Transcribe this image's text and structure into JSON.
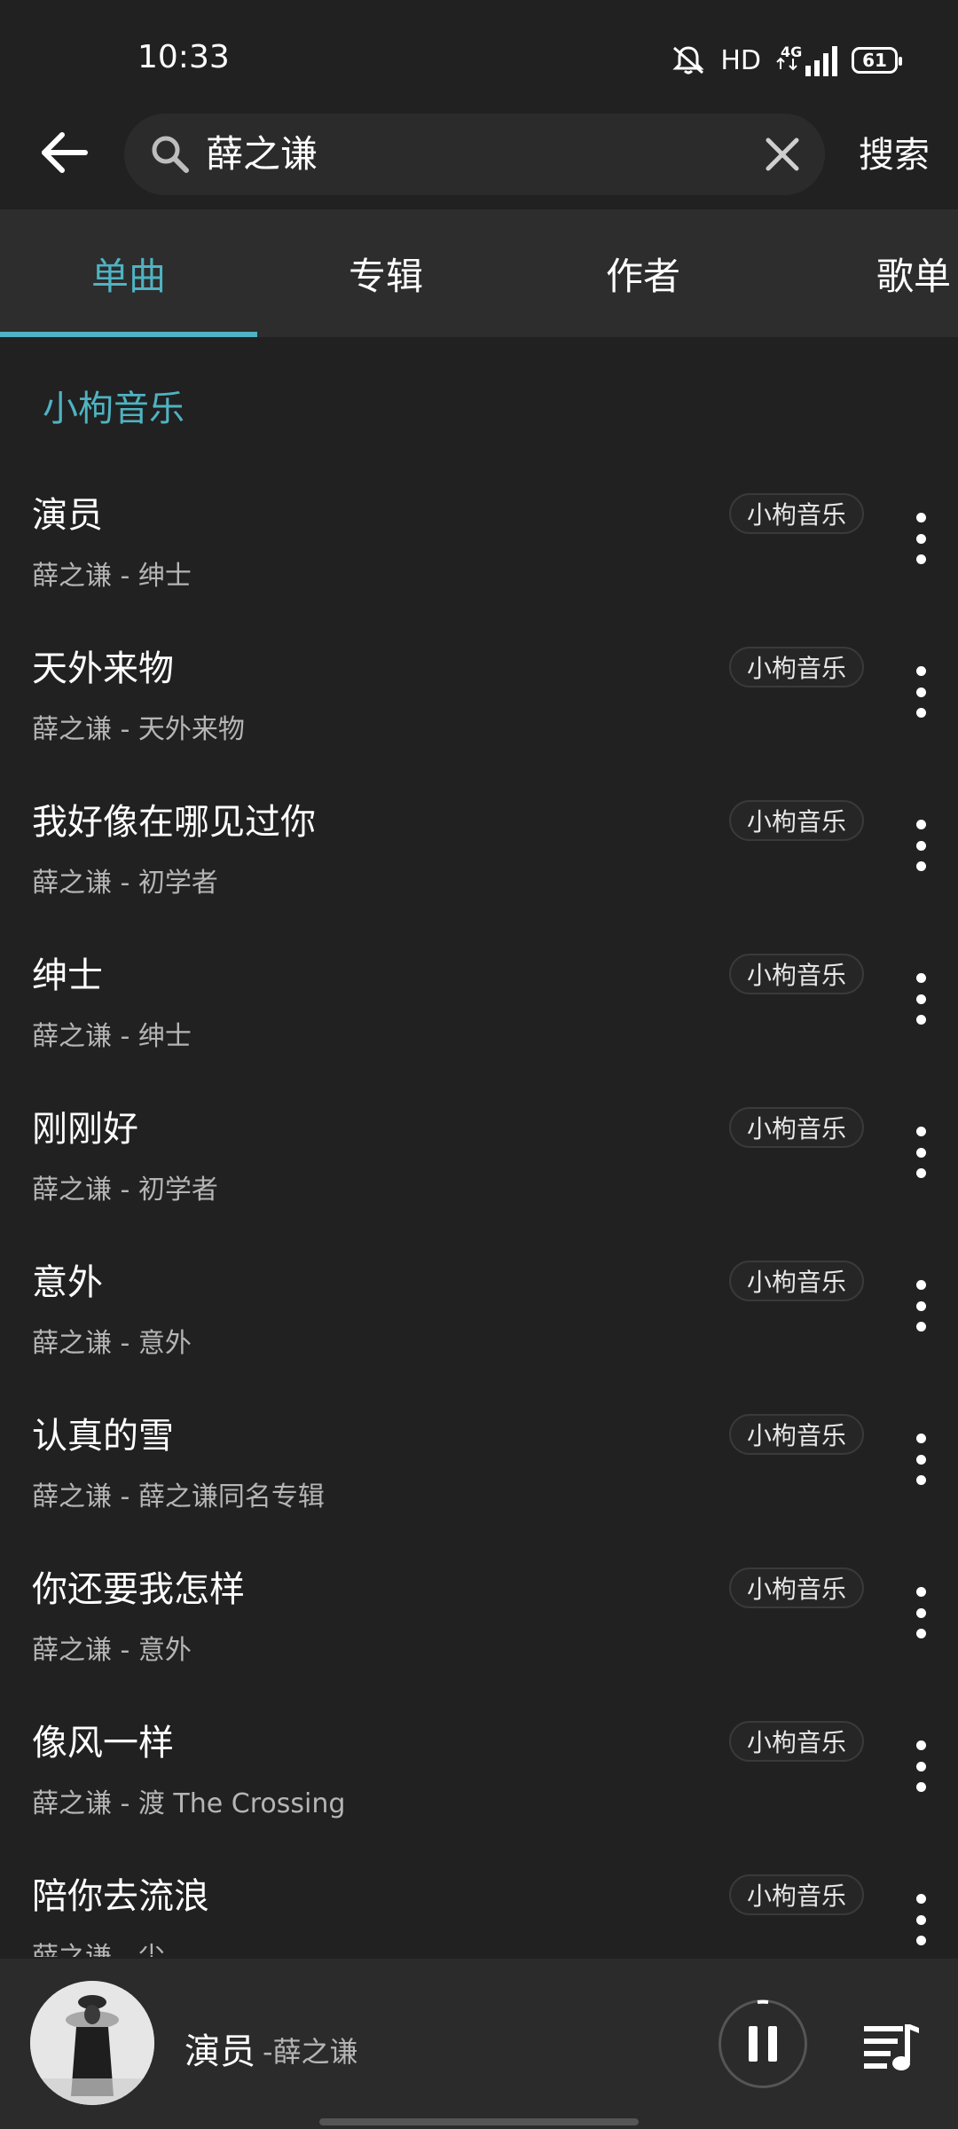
{
  "status_bar": {
    "time": "10:33",
    "hd": "HD",
    "network": "4G",
    "battery": "61"
  },
  "search": {
    "query": "薛之谦",
    "submit_label": "搜索"
  },
  "tabs": [
    {
      "label": "单曲",
      "active": true
    },
    {
      "label": "专辑",
      "active": false
    },
    {
      "label": "作者",
      "active": false
    },
    {
      "label": "歌单",
      "active": false
    }
  ],
  "section_title": "小枸音乐",
  "songs": [
    {
      "title": "演员",
      "subtitle": "薛之谦 - 绅士",
      "source": "小枸音乐"
    },
    {
      "title": "天外来物",
      "subtitle": "薛之谦 - 天外来物",
      "source": "小枸音乐"
    },
    {
      "title": "我好像在哪见过你",
      "subtitle": "薛之谦 - 初学者",
      "source": "小枸音乐"
    },
    {
      "title": "绅士",
      "subtitle": "薛之谦 - 绅士",
      "source": "小枸音乐"
    },
    {
      "title": "刚刚好",
      "subtitle": "薛之谦 - 初学者",
      "source": "小枸音乐"
    },
    {
      "title": "意外",
      "subtitle": "薛之谦 - 意外",
      "source": "小枸音乐"
    },
    {
      "title": "认真的雪",
      "subtitle": "薛之谦 - 薛之谦同名专辑",
      "source": "小枸音乐"
    },
    {
      "title": "你还要我怎样",
      "subtitle": "薛之谦 - 意外",
      "source": "小枸音乐"
    },
    {
      "title": "像风一样",
      "subtitle": "薛之谦 - 渡 The Crossing",
      "source": "小枸音乐"
    },
    {
      "title": "陪你去流浪",
      "subtitle": "薛之谦 - 尘",
      "source": "小枸音乐"
    }
  ],
  "player": {
    "title": "演员",
    "artist": "-薛之谦"
  },
  "colors": {
    "accent": "#4fb3c2",
    "background": "#212121",
    "tab_bar": "#2d2d2d"
  }
}
